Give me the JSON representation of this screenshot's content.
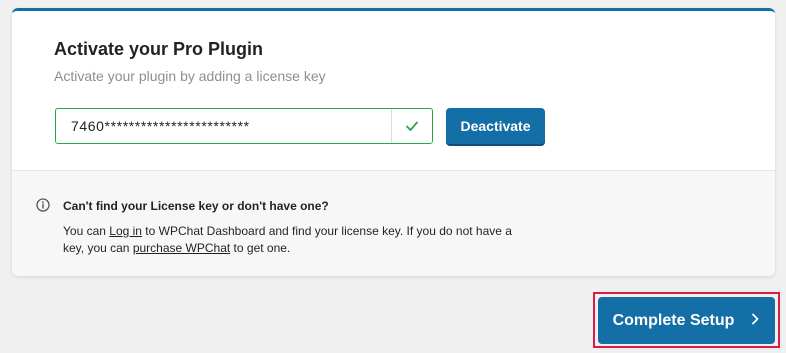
{
  "activation": {
    "title": "Activate your Pro Plugin",
    "subtitle": "Activate your plugin by adding a license key",
    "license_key_value": "7460************************",
    "deactivate_label": "Deactivate"
  },
  "help": {
    "heading": "Can't find your License key or don't have one?",
    "text_part1": "You can ",
    "login_link": "Log in",
    "text_part2": " to WPChat Dashboard and find your license key. If you do not have a key, you can ",
    "purchase_link": "purchase WPChat",
    "text_part3": " to get one."
  },
  "footer": {
    "complete_label": "Complete Setup"
  },
  "icons": {
    "valid": "check-icon",
    "info": "info-icon",
    "next": "chevron-right-icon"
  },
  "colors": {
    "primary": "#136fa6",
    "success": "#28a745",
    "highlight": "#d81b47"
  }
}
